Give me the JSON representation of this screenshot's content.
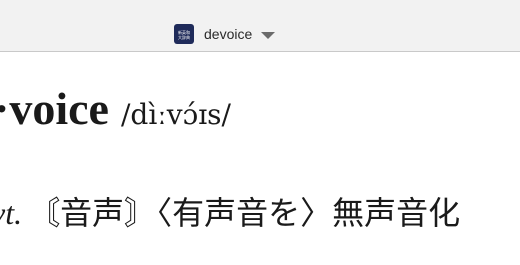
{
  "window": {
    "title": "devoice",
    "app_icon_lines": [
      "新英和",
      "大辞典"
    ]
  },
  "entry": {
    "headword": "·voice",
    "pronunciation": "/dìːvɔ́ɪs/",
    "part_of_speech": "vt.",
    "definition": "〘音声〙〈有声音を〉無声音化"
  },
  "icons": {
    "title_dropdown": "chevron-down-icon",
    "app_icon": "dictionary-app-icon"
  }
}
